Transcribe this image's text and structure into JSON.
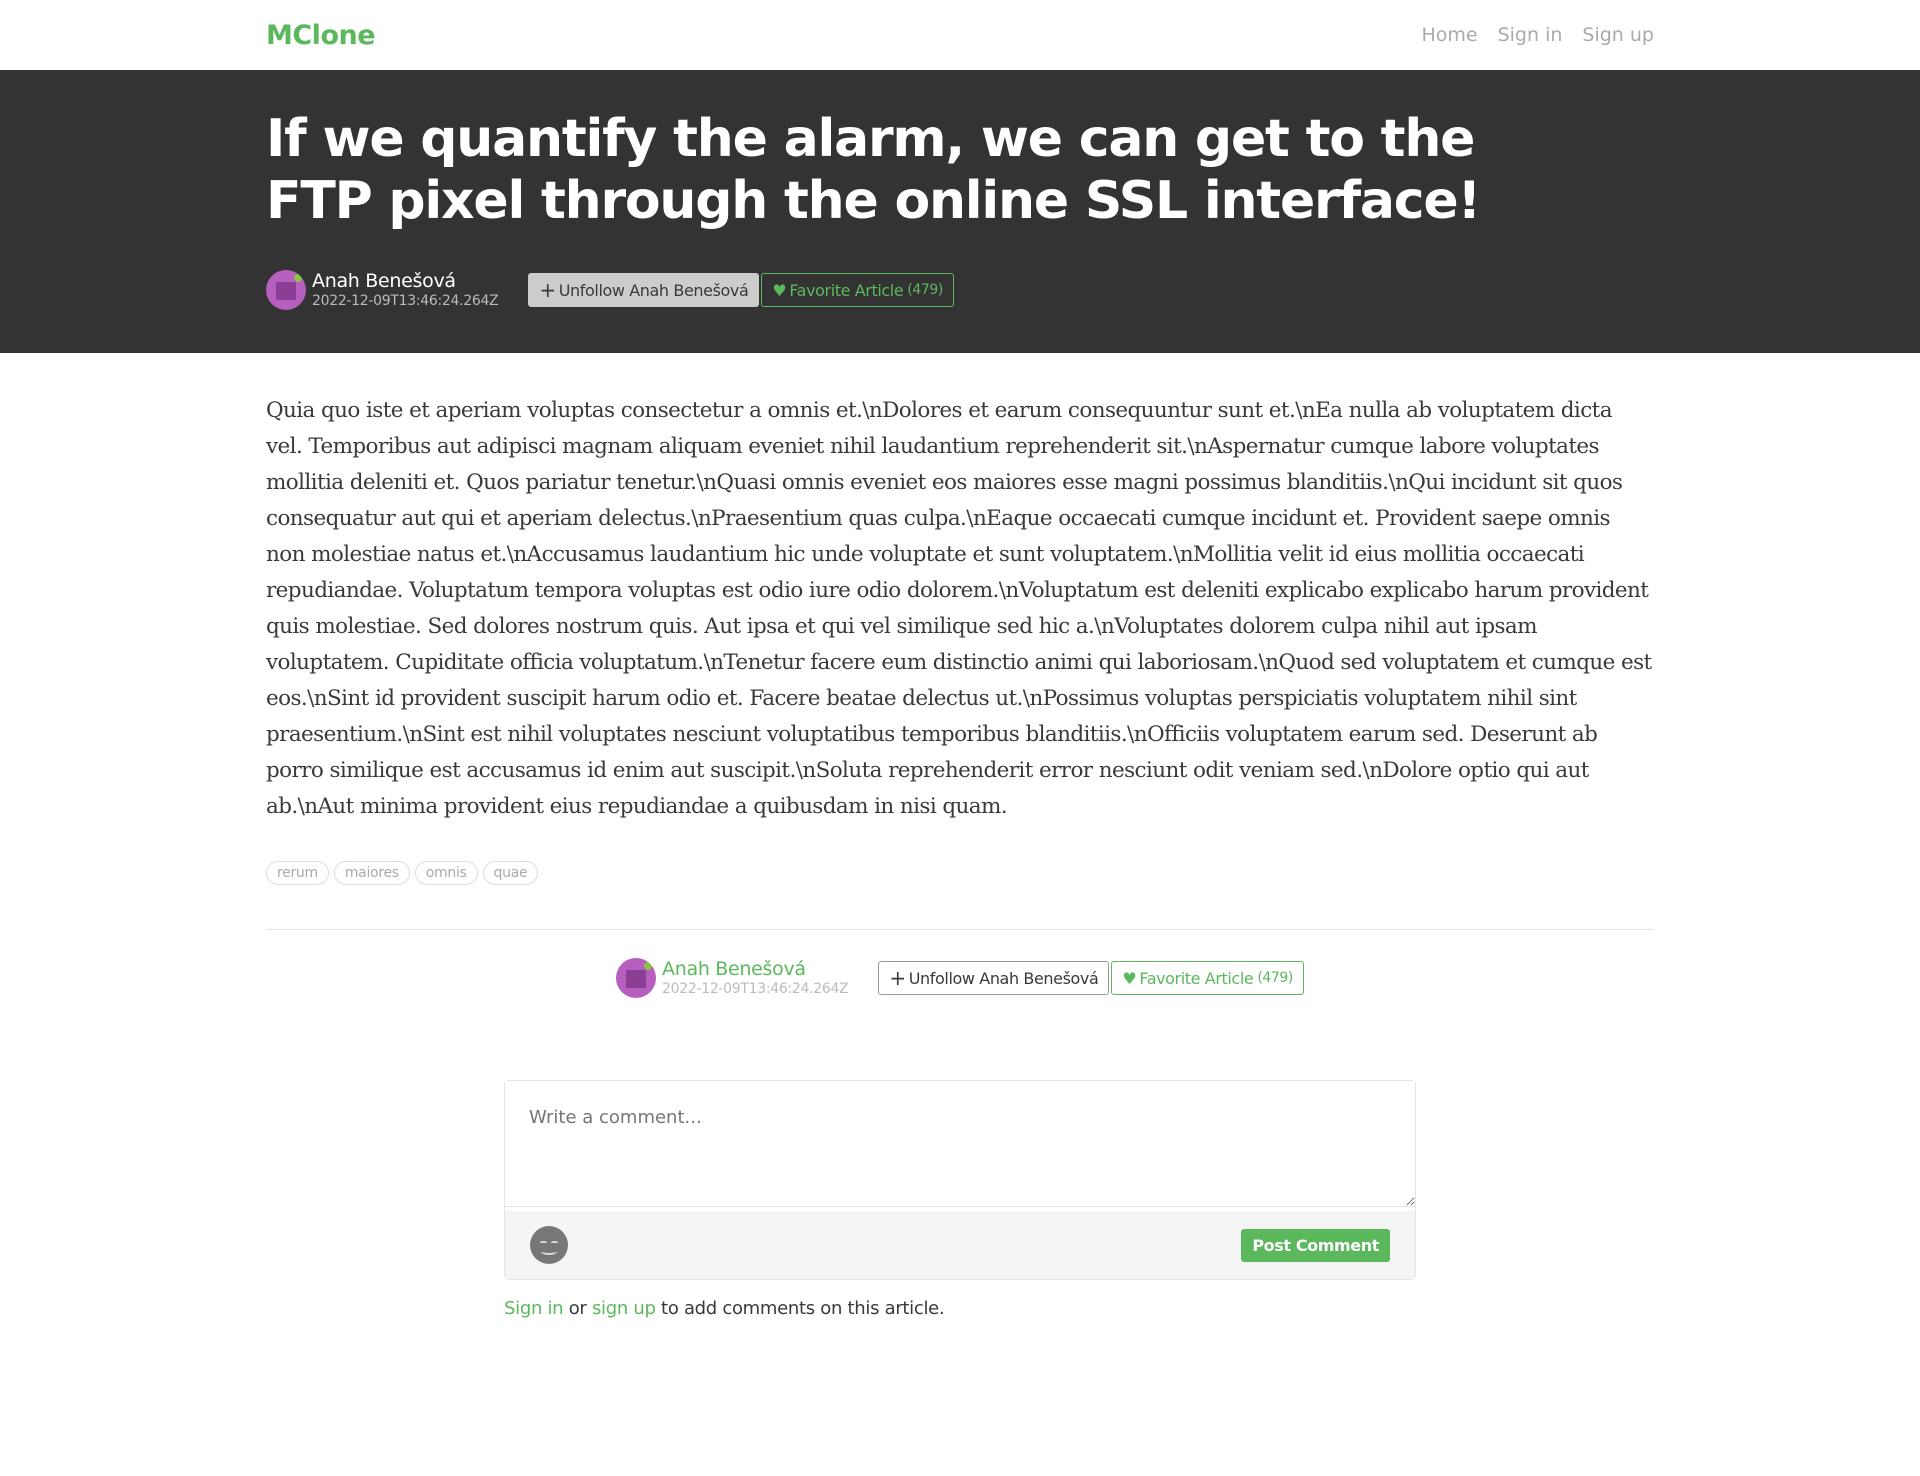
{
  "nav": {
    "brand": "MClone",
    "links": [
      "Home",
      "Sign in",
      "Sign up"
    ]
  },
  "article": {
    "title": "If we quantify the alarm, we can get to the FTP pixel through the online SSL interface!",
    "author": "Anah Benešová",
    "date": "2022-12-09T13:46:24.264Z",
    "follow_label": "Unfollow Anah Benešová",
    "favorite_label": "Favorite Article",
    "favorite_count": "(479)",
    "body": "Quia quo iste et aperiam voluptas consectetur a omnis et.\\nDolores et earum consequuntur sunt et.\\nEa nulla ab voluptatem dicta vel. Temporibus aut adipisci magnam aliquam eveniet nihil laudantium reprehenderit sit.\\nAspernatur cumque labore voluptates mollitia deleniti et. Quos pariatur tenetur.\\nQuasi omnis eveniet eos maiores esse magni possimus blanditiis.\\nQui incidunt sit quos consequatur aut qui et aperiam delectus.\\nPraesentium quas culpa.\\nEaque occaecati cumque incidunt et. Provident saepe omnis non molestiae natus et.\\nAccusamus laudantium hic unde voluptate et sunt voluptatem.\\nMollitia velit id eius mollitia occaecati repudiandae. Voluptatum tempora voluptas est odio iure odio dolorem.\\nVoluptatum est deleniti explicabo explicabo harum provident quis molestiae. Sed dolores nostrum quis. Aut ipsa et qui vel similique sed hic a.\\nVoluptates dolorem culpa nihil aut ipsam voluptatem. Cupiditate officia voluptatum.\\nTenetur facere eum distinctio animi qui laboriosam.\\nQuod sed voluptatem et cumque est eos.\\nSint id provident suscipit harum odio et. Facere beatae delectus ut.\\nPossimus voluptas perspiciatis voluptatem nihil sint praesentium.\\nSint est nihil voluptates nesciunt voluptatibus temporibus blanditiis.\\nOfficiis voluptatem earum sed. Deserunt ab porro similique est accusamus id enim aut suscipit.\\nSoluta reprehenderit error nesciunt odit veniam sed.\\nDolore optio qui aut ab.\\nAut minima provident eius repudiandae a quibusdam in nisi quam.",
    "tags": [
      "rerum",
      "maiores",
      "omnis",
      "quae"
    ]
  },
  "comment": {
    "placeholder": "Write a comment...",
    "post_label": "Post Comment",
    "signin_link": "Sign in",
    "or_text": " or ",
    "signup_link": "sign up",
    "suffix": " to add comments on this article."
  },
  "colors": {
    "accent": "#5cb85c",
    "banner": "#333333"
  },
  "icons": {
    "plus": "plus-icon",
    "heart": "heart-icon"
  }
}
